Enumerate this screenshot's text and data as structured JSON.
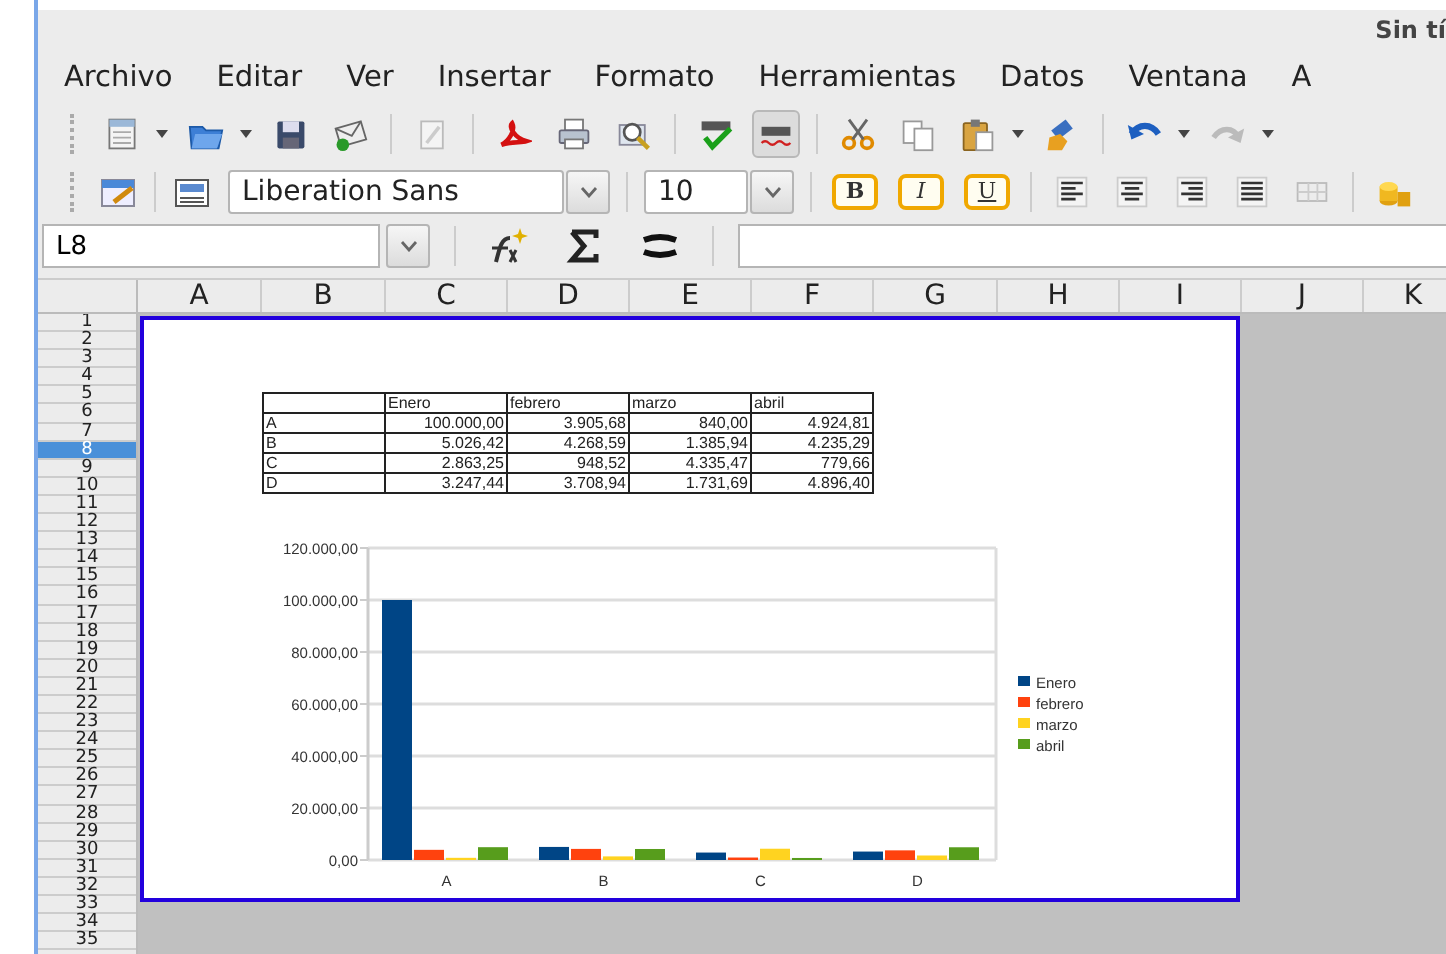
{
  "window": {
    "title": "Sin tí"
  },
  "menu": [
    "Archivo",
    "Editar",
    "Ver",
    "Insertar",
    "Formato",
    "Herramientas",
    "Datos",
    "Ventana",
    "A"
  ],
  "standard_toolbar": {
    "autospell_pressed": true
  },
  "format_toolbar": {
    "font": "Liberation Sans",
    "size": "10",
    "style_buttons": [
      "B",
      "I",
      "U"
    ]
  },
  "formula_bar": {
    "cell": "L8"
  },
  "columns": [
    "A",
    "B",
    "C",
    "D",
    "E",
    "F",
    "G",
    "H",
    "I",
    "J",
    "K"
  ],
  "rows": [
    {
      "label": "1",
      "selected": false
    },
    {
      "label": "2",
      "selected": false
    },
    {
      "label": "3",
      "selected": false
    },
    {
      "label": "4",
      "selected": false
    },
    {
      "label": "5",
      "selected": false
    },
    {
      "label": "6",
      "selected": false
    },
    {
      "label": "7",
      "selected": false
    },
    {
      "label": "8",
      "selected": true
    },
    {
      "label": "9",
      "selected": false
    },
    {
      "label": "10",
      "selected": false
    },
    {
      "label": "11",
      "selected": false
    },
    {
      "label": "12",
      "selected": false
    },
    {
      "label": "13",
      "selected": false
    },
    {
      "label": "14",
      "selected": false
    },
    {
      "label": "15",
      "selected": false
    },
    {
      "label": "16",
      "selected": false
    },
    {
      "label": "17",
      "selected": false
    },
    {
      "label": "18",
      "selected": false
    },
    {
      "label": "19",
      "selected": false
    },
    {
      "label": "20",
      "selected": false
    },
    {
      "label": "21",
      "selected": false
    },
    {
      "label": "22",
      "selected": false
    },
    {
      "label": "23",
      "selected": false
    },
    {
      "label": "24",
      "selected": false
    },
    {
      "label": "25",
      "selected": false
    },
    {
      "label": "26",
      "selected": false
    },
    {
      "label": "27",
      "selected": false
    },
    {
      "label": "28",
      "selected": false
    },
    {
      "label": "29",
      "selected": false
    },
    {
      "label": "30",
      "selected": false
    },
    {
      "label": "31",
      "selected": false
    },
    {
      "label": "32",
      "selected": false
    },
    {
      "label": "33",
      "selected": false
    },
    {
      "label": "34",
      "selected": false
    },
    {
      "label": "35",
      "selected": false
    }
  ],
  "embedded_object": {
    "table": {
      "header": [
        "Enero",
        "febrero",
        "marzo",
        "abril"
      ],
      "rows": [
        {
          "label": "A",
          "values": [
            "100.000,00",
            "3.905,68",
            "840,00",
            "4.924,81"
          ]
        },
        {
          "label": "B",
          "values": [
            "5.026,42",
            "4.268,59",
            "1.385,94",
            "4.235,29"
          ]
        },
        {
          "label": "C",
          "values": [
            "2.863,25",
            "948,52",
            "4.335,47",
            "779,66"
          ]
        },
        {
          "label": "D",
          "values": [
            "3.247,44",
            "3.708,94",
            "1.731,69",
            "4.896,40"
          ]
        }
      ]
    },
    "chart_data": {
      "type": "bar",
      "categories": [
        "A",
        "B",
        "C",
        "D"
      ],
      "series": [
        {
          "name": "Enero",
          "color": "#004586",
          "values": [
            100000,
            5026.42,
            2863.25,
            3247.44
          ]
        },
        {
          "name": "febrero",
          "color": "#ff420e",
          "values": [
            3905.68,
            4268.59,
            948.52,
            3708.94
          ]
        },
        {
          "name": "marzo",
          "color": "#ffd320",
          "values": [
            840,
            1385.94,
            4335.47,
            1731.69
          ]
        },
        {
          "name": "abril",
          "color": "#579d1c",
          "values": [
            4924.81,
            4235.29,
            779.66,
            4896.4
          ]
        }
      ],
      "ylim": [
        0,
        120000
      ],
      "grid": true,
      "legend": true,
      "yticks": [
        {
          "value": 0,
          "label": "0,00"
        },
        {
          "value": 20000,
          "label": "20.000,00"
        },
        {
          "value": 40000,
          "label": "40.000,00"
        },
        {
          "value": 60000,
          "label": "60.000,00"
        },
        {
          "value": 80000,
          "label": "80.000,00"
        },
        {
          "value": 100000,
          "label": "100.000,00"
        },
        {
          "value": 120000,
          "label": "120.000,00"
        }
      ]
    }
  }
}
